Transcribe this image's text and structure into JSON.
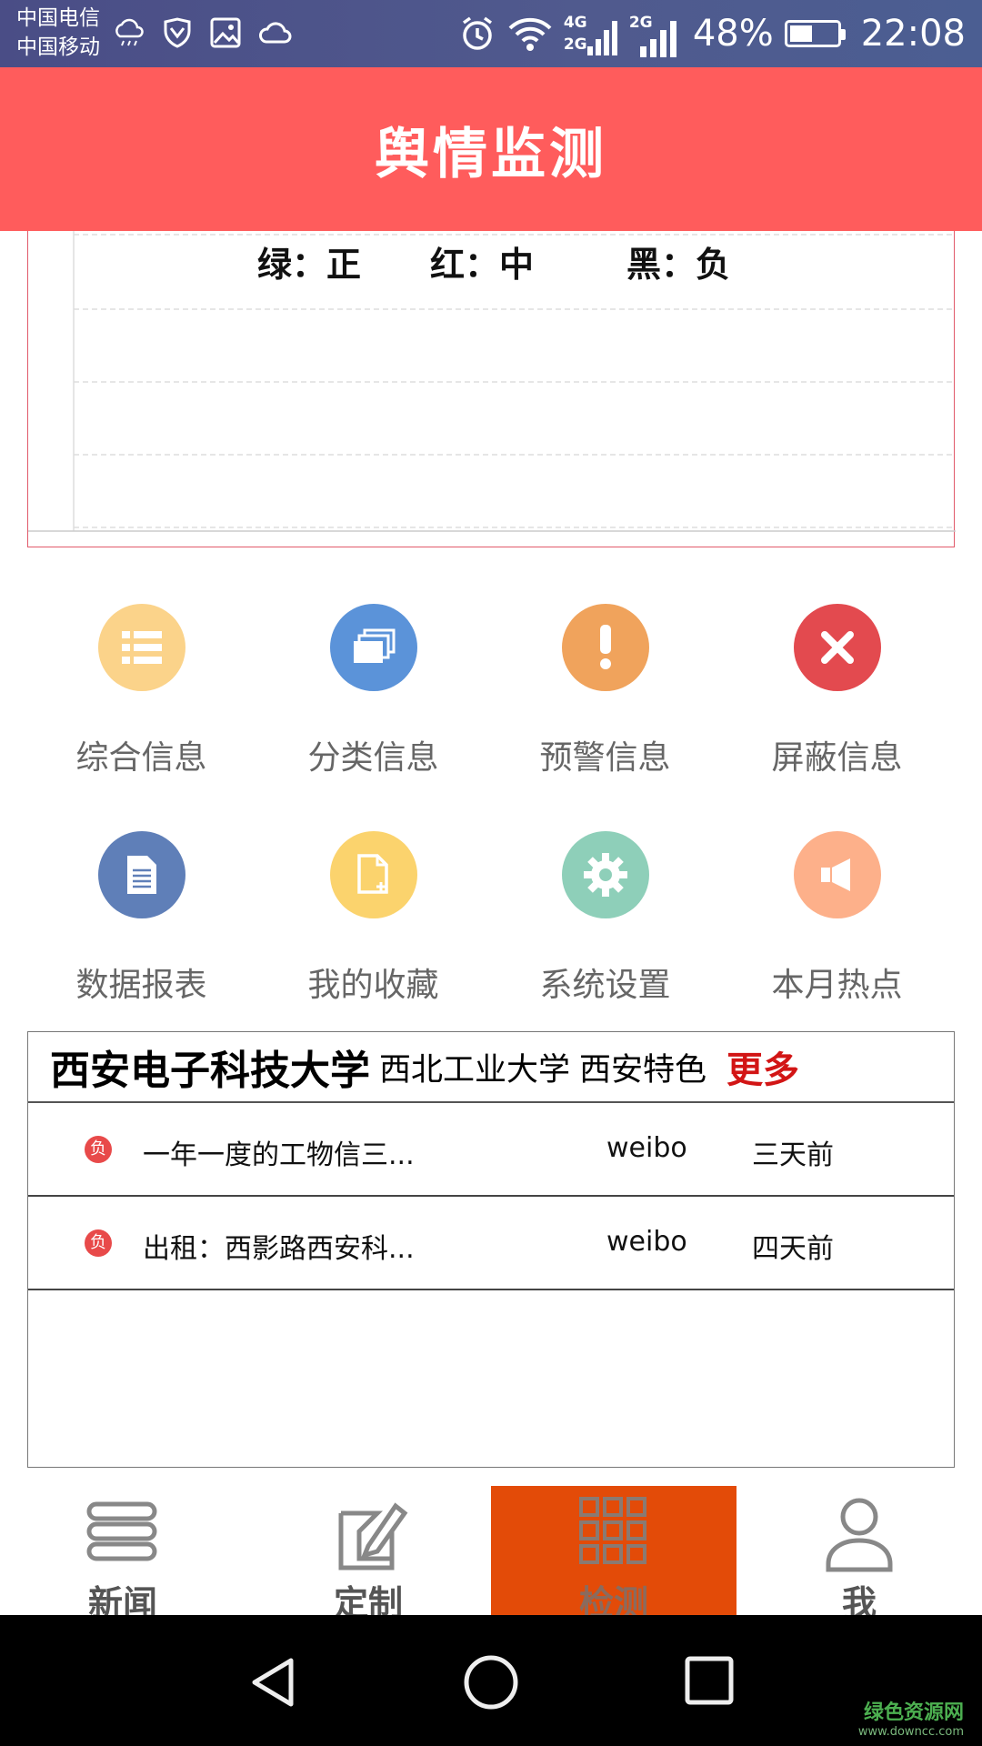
{
  "status_bar": {
    "carrier_1": "中国电信",
    "carrier_2": "中国移动",
    "network_1": "4G",
    "network_1b": "2G",
    "network_2": "2G",
    "battery_percent": "48%",
    "battery_level": 0.48,
    "time": "22:08"
  },
  "header": {
    "title": "舆情监测"
  },
  "chart_data": {
    "type": "bar",
    "legend": [
      {
        "label": "绿：正",
        "color": "#2e7d32"
      },
      {
        "label": "红：中",
        "color": "#d32f2f"
      },
      {
        "label": "黑：负",
        "color": "#111111"
      }
    ],
    "categories": [],
    "series": [],
    "grid": true
  },
  "menu": {
    "items": [
      {
        "label": "综合信息",
        "icon": "list-icon",
        "color": "#fbd38a"
      },
      {
        "label": "分类信息",
        "icon": "stack-icon",
        "color": "#5b93d9"
      },
      {
        "label": "预警信息",
        "icon": "exclamation-icon",
        "color": "#f0a35c"
      },
      {
        "label": "屏蔽信息",
        "icon": "close-icon",
        "color": "#e34a4f"
      },
      {
        "label": "数据报表",
        "icon": "document-icon",
        "color": "#5f7fb8"
      },
      {
        "label": "我的收藏",
        "icon": "add-file-icon",
        "color": "#fbd36d"
      },
      {
        "label": "系统设置",
        "icon": "gear-icon",
        "color": "#8ecfb9"
      },
      {
        "label": "本月热点",
        "icon": "speaker-icon",
        "color": "#fdb08a"
      }
    ]
  },
  "news": {
    "tab_active": "西安电子科技大学",
    "tab_2": "西北工业大学",
    "tab_3": "西安特色",
    "more": "更多",
    "rows": [
      {
        "badge": "负",
        "title": "一年一度的工物信三...",
        "source": "weibo",
        "time": "三天前"
      },
      {
        "badge": "负",
        "title": "出租：西影路西安科...",
        "source": "weibo",
        "time": "四天前"
      }
    ]
  },
  "bottom_nav": {
    "items": [
      {
        "label": "新闻",
        "icon": "menu-lines-icon"
      },
      {
        "label": "定制",
        "icon": "edit-icon"
      },
      {
        "label": "检测",
        "icon": "grid-icon",
        "active": true
      },
      {
        "label": "我",
        "icon": "user-icon"
      }
    ]
  },
  "watermark": {
    "line1": "绿色资源网",
    "line2": "www.downcc.com"
  }
}
